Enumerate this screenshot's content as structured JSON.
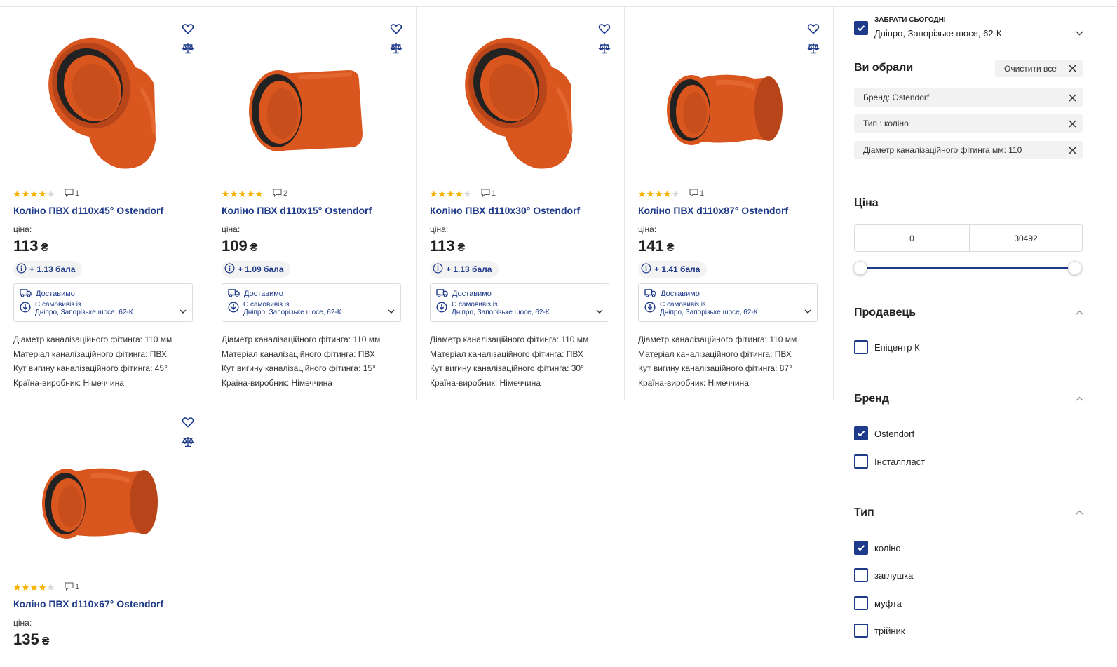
{
  "products": [
    {
      "name": "Коліно ПВХ d110x45° Ostendorf",
      "rating": 4,
      "reviews": "1",
      "price_label": "ціна:",
      "price": "113",
      "currency": "₴",
      "bonus": "+ 1.13 бала",
      "delivery": "Доставимо",
      "pickup_line1": "Є самовивіз із",
      "pickup_line2": "Дніпро, Запорізьке шосе, 62-К",
      "specs": [
        "Діаметр каналізаційного фітинга: 110 мм",
        "Матеріал каналізаційного фітинга: ПВХ",
        "Кут вигину каналізаційного фітинга: 45°",
        "Країна-виробник: Німеччина"
      ]
    },
    {
      "name": "Коліно ПВХ d110x15° Ostendorf",
      "rating": 5,
      "reviews": "2",
      "price_label": "ціна:",
      "price": "109",
      "currency": "₴",
      "bonus": "+ 1.09 бала",
      "delivery": "Доставимо",
      "pickup_line1": "Є самовивіз із",
      "pickup_line2": "Дніпро, Запорізьке шосе, 62-К",
      "specs": [
        "Діаметр каналізаційного фітинга: 110 мм",
        "Матеріал каналізаційного фітинга: ПВХ",
        "Кут вигину каналізаційного фітинга: 15°",
        "Країна-виробник: Німеччина"
      ]
    },
    {
      "name": "Коліно ПВХ d110x30° Ostendorf",
      "rating": 4,
      "reviews": "1",
      "price_label": "ціна:",
      "price": "113",
      "currency": "₴",
      "bonus": "+ 1.13 бала",
      "delivery": "Доставимо",
      "pickup_line1": "Є самовивіз із",
      "pickup_line2": "Дніпро, Запорізьке шосе, 62-К",
      "specs": [
        "Діаметр каналізаційного фітинга: 110 мм",
        "Матеріал каналізаційного фітинга: ПВХ",
        "Кут вигину каналізаційного фітинга: 30°",
        "Країна-виробник: Німеччина"
      ]
    },
    {
      "name": "Коліно ПВХ d110x87° Ostendorf",
      "rating": 4,
      "reviews": "1",
      "price_label": "ціна:",
      "price": "141",
      "currency": "₴",
      "bonus": "+ 1.41 бала",
      "delivery": "Доставимо",
      "pickup_line1": "Є самовивіз із",
      "pickup_line2": "Дніпро, Запорізьке шосе, 62-К",
      "specs": [
        "Діаметр каналізаційного фітинга: 110 мм",
        "Матеріал каналізаційного фітинга: ПВХ",
        "Кут вигину каналізаційного фітинга: 87°",
        "Країна-виробник: Німеччина"
      ]
    },
    {
      "name": "Коліно ПВХ d110x67° Ostendorf",
      "rating": 4,
      "reviews": "1",
      "price_label": "ціна:",
      "price": "135",
      "currency": "₴"
    }
  ],
  "sidebar": {
    "pickup_title": "ЗАБРАТИ СЬОГОДНІ",
    "pickup_address": "Дніпро, Запорізьке шосе, 62-К",
    "pickup_checked": true,
    "selected_title": "Ви обрали",
    "clear_all": "Очистити все",
    "chips": [
      "Бренд: Ostendorf",
      "Тип : коліно",
      "Діаметр каналізаційного фітинга мм: 110"
    ],
    "price_title": "Ціна",
    "price_min": "0",
    "price_max": "30492",
    "seller_title": "Продавець",
    "sellers": [
      {
        "label": "Епіцентр К",
        "checked": false
      }
    ],
    "brand_title": "Бренд",
    "brands": [
      {
        "label": "Ostendorf",
        "checked": true
      },
      {
        "label": "Інсталпласт",
        "checked": false
      }
    ],
    "type_title": "Тип",
    "types": [
      {
        "label": "коліно",
        "checked": true
      },
      {
        "label": "заглушка",
        "checked": false
      },
      {
        "label": "муфта",
        "checked": false
      },
      {
        "label": "трійник",
        "checked": false
      }
    ]
  },
  "colors": {
    "accent": "#1e3a8a",
    "star": "#f5b301",
    "pipe": "#d9561f"
  },
  "icons": [
    "heart-icon",
    "compare-scales-icon",
    "comment-icon",
    "info-icon",
    "truck-icon",
    "pickup-pin-icon",
    "chevron-down-icon",
    "close-icon",
    "check-icon"
  ]
}
